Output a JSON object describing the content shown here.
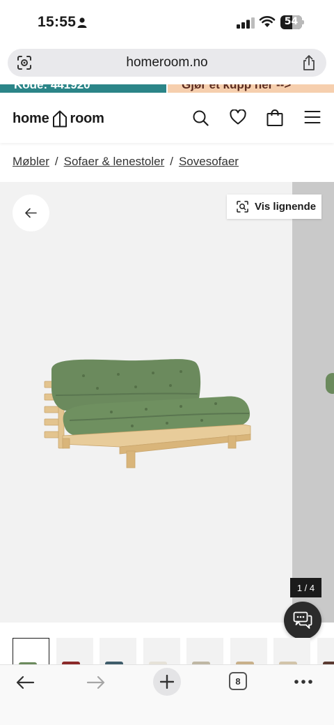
{
  "status_bar": {
    "time": "15:55",
    "battery": "54",
    "battery_level": 0.54
  },
  "browser": {
    "url": "homeroom.no",
    "tab_count": "8"
  },
  "promo": {
    "left_text": "Kode: 441920",
    "right_text": "Gjør et kupp her -->"
  },
  "header": {
    "logo_left": "home",
    "logo_right": "room",
    "icons": [
      "search-icon",
      "heart-icon",
      "bag-icon",
      "menu-icon"
    ]
  },
  "breadcrumb": [
    "Møbler",
    "Sofaer & lenestoler",
    "Sovesofaer"
  ],
  "breadcrumb_separator": "/",
  "gallery": {
    "similar_label": "Vis lignende",
    "counter": "1 / 4"
  },
  "thumbnails": [
    {
      "swatch": "#6b8a5d",
      "active": true
    },
    {
      "swatch": "#8b2a2a",
      "active": false
    },
    {
      "swatch": "#3f5d6b",
      "active": false
    },
    {
      "swatch": "#e6e2d8",
      "active": false
    },
    {
      "swatch": "#bfb7a4",
      "active": false
    },
    {
      "swatch": "#c8b08a",
      "active": false
    },
    {
      "swatch": "#d2c4aa",
      "active": false
    },
    {
      "swatch": "#5b3a32",
      "active": false
    }
  ],
  "colors": {
    "promo_left": "#2b8588",
    "promo_right": "#f6cfae",
    "sofa_cushion": "#6b8a5d",
    "sofa_frame": "#e3c48f"
  }
}
